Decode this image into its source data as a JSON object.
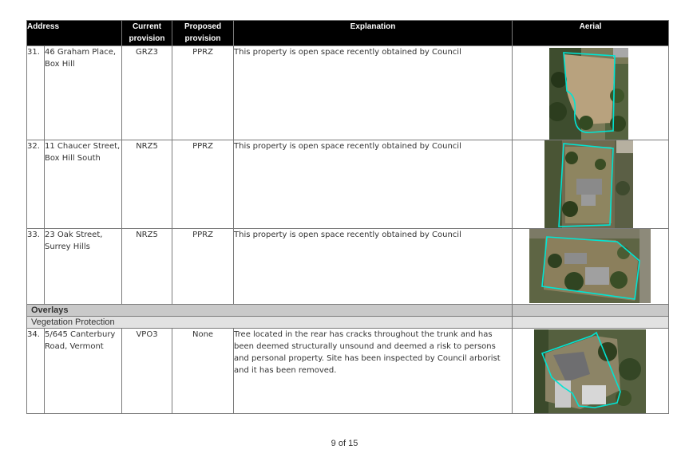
{
  "table": {
    "headers": {
      "address": "Address",
      "current": "Current provision",
      "proposed": "Proposed provision",
      "explanation": "Explanation",
      "aerial": "Aerial"
    },
    "rows": [
      {
        "number": "31.",
        "address": "46 Graham Place, Box Hill",
        "current": "GRZ3",
        "proposed": "PPRZ",
        "explanation": "This property is open space recently obtained by Council"
      },
      {
        "number": "32.",
        "address": "11 Chaucer Street, Box Hill South",
        "current": "NRZ5",
        "proposed": "PPRZ",
        "explanation": "This property is open space recently obtained by Council"
      },
      {
        "number": "33.",
        "address": "23 Oak Street, Surrey Hills",
        "current": "NRZ5",
        "proposed": "PPRZ",
        "explanation": "This property is open space recently obtained by Council"
      },
      {
        "number": "34.",
        "address": "5/645 Canterbury Road, Vermont",
        "current": "VPO3",
        "proposed": "None",
        "explanation": "Tree located in the rear has cracks throughout the trunk and has been deemed structurally unsound and deemed a risk to persons and personal property. Site has been inspected by Council arborist and it has been removed."
      }
    ],
    "sections": {
      "overlays": "Overlays",
      "vegetation": "Vegetation Protection"
    }
  },
  "aerial": {
    "boundary_color": "#00e5d4"
  },
  "footer": {
    "page": "9 of 15"
  }
}
